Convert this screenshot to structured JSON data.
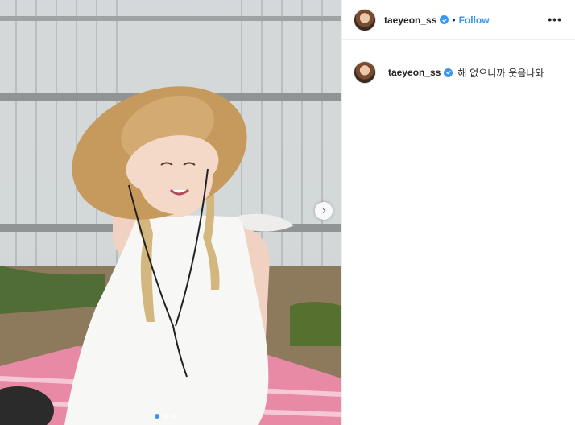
{
  "post": {
    "image_alt": "Photo of a woman with braided hair wearing a straw hat and a white sleeveless top, sitting on a pink gingham picnic blanket in front of a corrugated wall",
    "carousel": {
      "total": 3,
      "current": 1
    }
  },
  "header": {
    "username": "taeyeon_ss",
    "separator": "•",
    "follow_label": "Follow",
    "more_label": "•••"
  },
  "comment": {
    "username": "taeyeon_ss",
    "text": "해 없으니까 웃음나와"
  },
  "colors": {
    "accent": "#3897f0",
    "text": "#262626",
    "border": "#efefef"
  }
}
